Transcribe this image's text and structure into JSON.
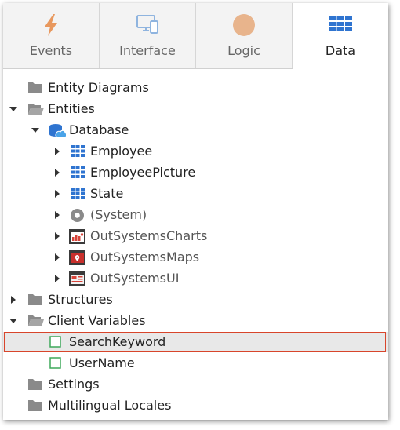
{
  "tabs": [
    {
      "label": "Events",
      "icon": "lightning-icon",
      "color": "#e8985e"
    },
    {
      "label": "Interface",
      "icon": "devices-icon",
      "color": "#8fb4df"
    },
    {
      "label": "Logic",
      "icon": "circle-icon",
      "color": "#e8b48c"
    },
    {
      "label": "Data",
      "icon": "grid-table-icon",
      "color": "#2f74d0",
      "active": true
    }
  ],
  "tree": {
    "entity_diagrams": "Entity Diagrams",
    "entities": "Entities",
    "database": "Database",
    "employee": "Employee",
    "employee_picture": "EmployeePicture",
    "state": "State",
    "system": "(System)",
    "os_charts": "OutSystemsCharts",
    "os_maps": "OutSystemsMaps",
    "os_ui": "OutSystemsUI",
    "structures": "Structures",
    "client_variables": "Client Variables",
    "search_keyword": "SearchKeyword",
    "user_name": "UserName",
    "settings": "Settings",
    "multilingual": "Multilingual Locales"
  }
}
